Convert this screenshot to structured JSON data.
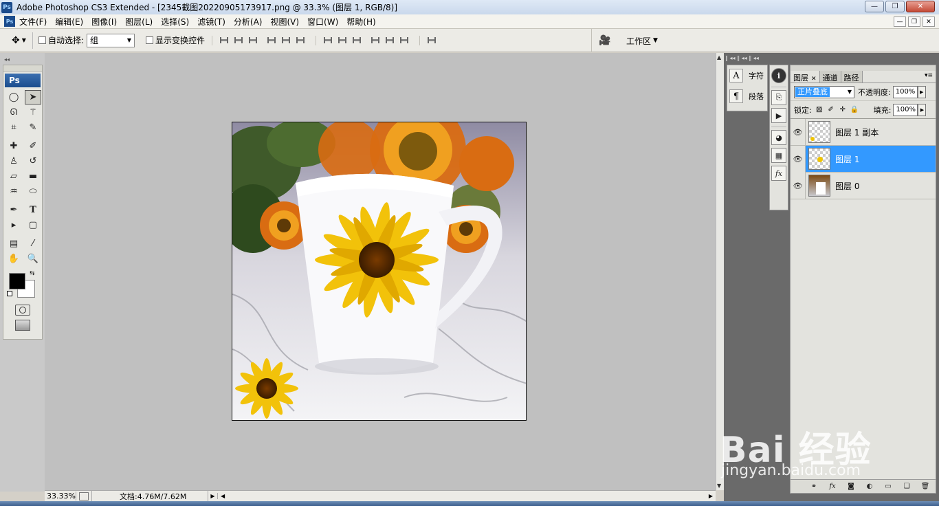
{
  "app": {
    "title": "Adobe Photoshop CS3 Extended - [2345截图20220905173917.png @ 33.3% (图层 1, RGB/8)]",
    "logo": "Ps",
    "window_buttons": [
      "—",
      "❐",
      "✕"
    ],
    "doc_buttons": [
      "—",
      "❐",
      "✕"
    ]
  },
  "menu": [
    "文件(F)",
    "编辑(E)",
    "图像(I)",
    "图层(L)",
    "选择(S)",
    "滤镜(T)",
    "分析(A)",
    "视图(V)",
    "窗口(W)",
    "帮助(H)"
  ],
  "options": {
    "tool_icon": "move-tool-icon",
    "auto_select_label": "自动选择:",
    "auto_select_value": "组",
    "show_transform_label": "显示变换控件",
    "workspace_label": "工作区"
  },
  "toolbox": {
    "title": "Ps",
    "tools": [
      "marquee-tool-icon",
      "move-tool-icon",
      "lasso-tool-icon",
      "magic-wand-icon",
      "crop-tool-icon",
      "slice-tool-icon",
      "healing-brush-icon",
      "brush-tool-icon",
      "clone-stamp-icon",
      "history-brush-icon",
      "eraser-tool-icon",
      "gradient-tool-icon",
      "blur-tool-icon",
      "dodge-tool-icon",
      "pen-tool-icon",
      "type-tool-icon",
      "path-select-icon",
      "shape-tool-icon",
      "notes-tool-icon",
      "eyedropper-icon",
      "hand-tool-icon",
      "zoom-tool-icon"
    ],
    "foreground": "#000000",
    "background": "#ffffff"
  },
  "status": {
    "zoom": "33.33%",
    "doc_info": "文档:4.76M/7.62M"
  },
  "char_panel": {
    "character_label": "字符",
    "paragraph_label": "段落"
  },
  "layers_panel": {
    "tabs": [
      "图层",
      "通道",
      "路径"
    ],
    "blend_mode": "正片叠底",
    "opacity_label": "不透明度:",
    "opacity": "100%",
    "lock_label": "锁定:",
    "fill_label": "填充:",
    "fill": "100%",
    "layers": [
      {
        "name": "图层 1 副本",
        "selected": false
      },
      {
        "name": "图层 1",
        "selected": true
      },
      {
        "name": "图层 0",
        "selected": false
      }
    ]
  },
  "watermark": {
    "brand": "Bai  经验",
    "url": "jingyan.baidu.com"
  },
  "colors": {
    "selection": "#3399ff",
    "dock": "#6a6a6a",
    "canvas_bg": "#c0c0c0"
  }
}
